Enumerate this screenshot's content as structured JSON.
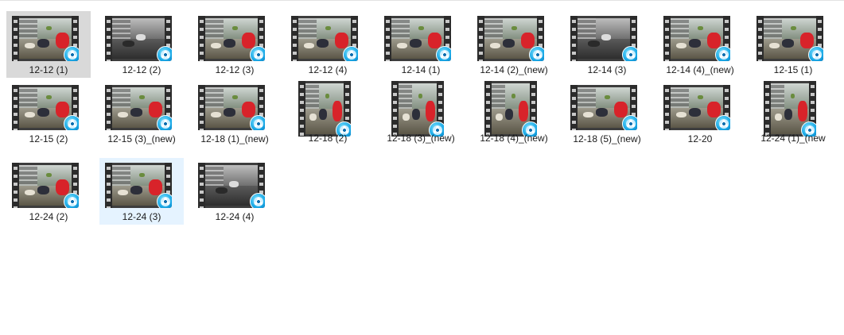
{
  "files": [
    {
      "name": "12-12 (1)",
      "state": "selected",
      "tone": "color",
      "icon": "video-file-icon"
    },
    {
      "name": "12-12 (2)",
      "state": "normal",
      "tone": "gray",
      "icon": "video-file-icon"
    },
    {
      "name": "12-12 (3)",
      "state": "normal",
      "tone": "color",
      "icon": "video-file-icon"
    },
    {
      "name": "12-12 (4)",
      "state": "normal",
      "tone": "color",
      "icon": "video-file-icon"
    },
    {
      "name": "12-14 (1)",
      "state": "normal",
      "tone": "color",
      "icon": "video-file-icon"
    },
    {
      "name": "12-14 (2)_(new)",
      "state": "normal",
      "tone": "color",
      "icon": "video-file-icon"
    },
    {
      "name": "12-14 (3)",
      "state": "normal",
      "tone": "gray",
      "icon": "video-file-icon"
    },
    {
      "name": "12-14 (4)_(new)",
      "state": "normal",
      "tone": "color",
      "icon": "video-file-icon"
    },
    {
      "name": "12-15 (1)",
      "state": "normal",
      "tone": "color",
      "icon": "video-file-icon"
    },
    {
      "name": "12-15 (2)",
      "state": "normal",
      "tone": "color",
      "icon": "video-file-icon"
    },
    {
      "name": "12-15 (3)_(new)",
      "state": "normal",
      "tone": "color",
      "icon": "video-file-icon"
    },
    {
      "name": "12-18 (1)_(new)",
      "state": "normal",
      "tone": "color",
      "icon": "video-file-icon"
    },
    {
      "name": "12-18 (2)",
      "state": "normal",
      "tone": "color",
      "icon": "video-file-icon"
    },
    {
      "name": "12-18 (3)_(new)",
      "state": "normal",
      "tone": "color",
      "icon": "video-file-icon"
    },
    {
      "name": "12-18 (4)_(new)",
      "state": "normal",
      "tone": "color",
      "icon": "video-file-icon"
    },
    {
      "name": "12-18 (5)_(new)",
      "state": "normal",
      "tone": "color",
      "icon": "video-file-icon"
    },
    {
      "name": "12-20",
      "state": "normal",
      "tone": "color",
      "icon": "video-file-icon"
    },
    {
      "name": "12-24 (1)_(new",
      "state": "normal",
      "tone": "color",
      "icon": "video-file-icon"
    },
    {
      "name": "12-24 (2)",
      "state": "normal",
      "tone": "color",
      "icon": "video-file-icon"
    },
    {
      "name": "12-24 (3)",
      "state": "hover",
      "tone": "color",
      "icon": "video-file-icon"
    },
    {
      "name": "12-24 (4)",
      "state": "normal",
      "tone": "gray",
      "icon": "video-file-icon"
    }
  ],
  "colors": {
    "selected_bg": "#d9d9d9",
    "hover_bg": "#e5f3ff",
    "badge": "#18a8e6",
    "accent_red": "#d8232a"
  }
}
